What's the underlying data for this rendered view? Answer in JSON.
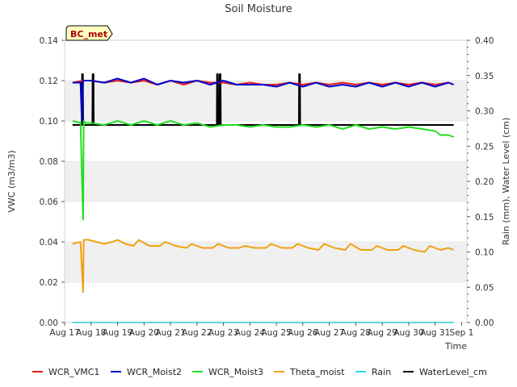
{
  "chart_data": {
    "type": "line",
    "title": "Soil Moisture",
    "xlabel": "Time",
    "ylabel_left": "VWC (m3/m3)",
    "ylabel_right": "Rain (mm), Water Level (cm)",
    "xlim": [
      0,
      15.2
    ],
    "ylim_left": [
      0,
      0.14
    ],
    "ylim_right": [
      0,
      0.4
    ],
    "x_ticks": [
      "Aug 17",
      "Aug 18",
      "Aug 19",
      "Aug 20",
      "Aug 21",
      "Aug 22",
      "Aug 23",
      "Aug 24",
      "Aug 25",
      "Aug 26",
      "Aug 27",
      "Aug 28",
      "Aug 29",
      "Aug 30",
      "Aug 31",
      "Sep 1"
    ],
    "left_ticks": [
      "0.00",
      "0.02",
      "0.04",
      "0.06",
      "0.08",
      "0.10",
      "0.12",
      "0.14"
    ],
    "right_ticks": [
      "0.00",
      "0.05",
      "0.10",
      "0.15",
      "0.20",
      "0.25",
      "0.30",
      "0.35",
      "0.40"
    ],
    "grid_bands": true,
    "annotation": "BC_met",
    "legend_placement": "bottom",
    "series": [
      {
        "name": "WCR_VMC1",
        "color": "#e41a1c",
        "axis": "left",
        "x": [
          0.3,
          0.7,
          1.0,
          1.5,
          2.0,
          2.5,
          3.0,
          3.5,
          4.0,
          4.5,
          5.0,
          5.5,
          6.0,
          6.5,
          7.0,
          7.5,
          8.0,
          8.5,
          9.0,
          9.5,
          10.0,
          10.5,
          11.0,
          11.5,
          12.0,
          12.5,
          13.0,
          13.5,
          14.0,
          14.5,
          14.7
        ],
        "y": [
          0.119,
          0.12,
          0.12,
          0.119,
          0.12,
          0.119,
          0.12,
          0.118,
          0.12,
          0.118,
          0.12,
          0.119,
          0.119,
          0.118,
          0.119,
          0.118,
          0.118,
          0.119,
          0.118,
          0.119,
          0.118,
          0.119,
          0.118,
          0.119,
          0.118,
          0.119,
          0.118,
          0.119,
          0.118,
          0.119,
          0.118
        ]
      },
      {
        "name": "WCR_Moist2",
        "color": "#0000cc",
        "axis": "left",
        "x": [
          0.3,
          0.6,
          0.65,
          0.7,
          0.72,
          1.0,
          1.5,
          2.0,
          2.5,
          3.0,
          3.5,
          4.0,
          4.5,
          5.0,
          5.5,
          6.0,
          6.5,
          7.0,
          7.5,
          8.0,
          8.5,
          9.0,
          9.5,
          10.0,
          10.5,
          11.0,
          11.5,
          12.0,
          12.5,
          13.0,
          13.5,
          14.0,
          14.5,
          14.7
        ],
        "y": [
          0.119,
          0.119,
          0.1,
          0.12,
          0.12,
          0.12,
          0.119,
          0.121,
          0.119,
          0.121,
          0.118,
          0.12,
          0.119,
          0.12,
          0.118,
          0.12,
          0.118,
          0.118,
          0.118,
          0.117,
          0.119,
          0.117,
          0.119,
          0.117,
          0.118,
          0.117,
          0.119,
          0.117,
          0.119,
          0.117,
          0.119,
          0.117,
          0.119,
          0.118
        ]
      },
      {
        "name": "WCR_Moist3",
        "color": "#22dd22",
        "axis": "left",
        "x": [
          0.3,
          0.6,
          0.7,
          0.72,
          0.8,
          1.0,
          1.5,
          2.0,
          2.5,
          3.0,
          3.5,
          4.0,
          4.5,
          5.0,
          5.5,
          6.0,
          6.5,
          7.0,
          7.5,
          8.0,
          8.5,
          9.0,
          9.5,
          10.0,
          10.5,
          11.0,
          11.5,
          12.0,
          12.5,
          13.0,
          13.5,
          14.0,
          14.2,
          14.5,
          14.7
        ],
        "y": [
          0.1,
          0.099,
          0.051,
          0.1,
          0.099,
          0.099,
          0.098,
          0.1,
          0.098,
          0.1,
          0.098,
          0.1,
          0.098,
          0.099,
          0.097,
          0.098,
          0.098,
          0.097,
          0.098,
          0.097,
          0.097,
          0.098,
          0.097,
          0.098,
          0.096,
          0.098,
          0.096,
          0.097,
          0.096,
          0.097,
          0.096,
          0.095,
          0.093,
          0.093,
          0.092
        ]
      },
      {
        "name": "Theta_moist",
        "color": "#f0a010",
        "axis": "left",
        "x": [
          0.3,
          0.6,
          0.7,
          0.72,
          0.9,
          1.2,
          1.5,
          1.8,
          2.0,
          2.3,
          2.6,
          2.8,
          3.2,
          3.6,
          3.8,
          4.2,
          4.6,
          4.8,
          5.2,
          5.6,
          5.8,
          6.2,
          6.6,
          6.8,
          7.2,
          7.6,
          7.8,
          8.2,
          8.6,
          8.8,
          9.2,
          9.6,
          9.8,
          10.2,
          10.6,
          10.8,
          11.2,
          11.6,
          11.8,
          12.2,
          12.6,
          12.8,
          13.2,
          13.6,
          13.8,
          14.2,
          14.5,
          14.7
        ],
        "y": [
          0.039,
          0.04,
          0.015,
          0.041,
          0.041,
          0.04,
          0.039,
          0.04,
          0.041,
          0.039,
          0.038,
          0.041,
          0.038,
          0.038,
          0.04,
          0.038,
          0.037,
          0.039,
          0.037,
          0.037,
          0.039,
          0.037,
          0.037,
          0.038,
          0.037,
          0.037,
          0.039,
          0.037,
          0.037,
          0.039,
          0.037,
          0.036,
          0.039,
          0.037,
          0.036,
          0.039,
          0.036,
          0.036,
          0.038,
          0.036,
          0.036,
          0.038,
          0.036,
          0.035,
          0.038,
          0.036,
          0.037,
          0.036
        ]
      },
      {
        "name": "Rain",
        "color": "#22dddd",
        "axis": "right",
        "x": [
          0.3,
          14.7
        ],
        "y": [
          0.0,
          0.0
        ]
      },
      {
        "name": "WaterLevel_cm",
        "color": "#000000",
        "axis": "right",
        "x": [
          0.3,
          0.65,
          0.66,
          0.69,
          0.7,
          1.05,
          1.06,
          1.09,
          1.1,
          5.75,
          5.76,
          5.79,
          5.8,
          5.85,
          5.86,
          5.89,
          5.9,
          8.85,
          8.86,
          8.89,
          8.9,
          14.7
        ],
        "y": [
          0.28,
          0.28,
          0.352,
          0.352,
          0.28,
          0.28,
          0.352,
          0.352,
          0.28,
          0.28,
          0.352,
          0.352,
          0.28,
          0.28,
          0.352,
          0.352,
          0.28,
          0.28,
          0.352,
          0.352,
          0.28,
          0.28
        ]
      }
    ]
  }
}
